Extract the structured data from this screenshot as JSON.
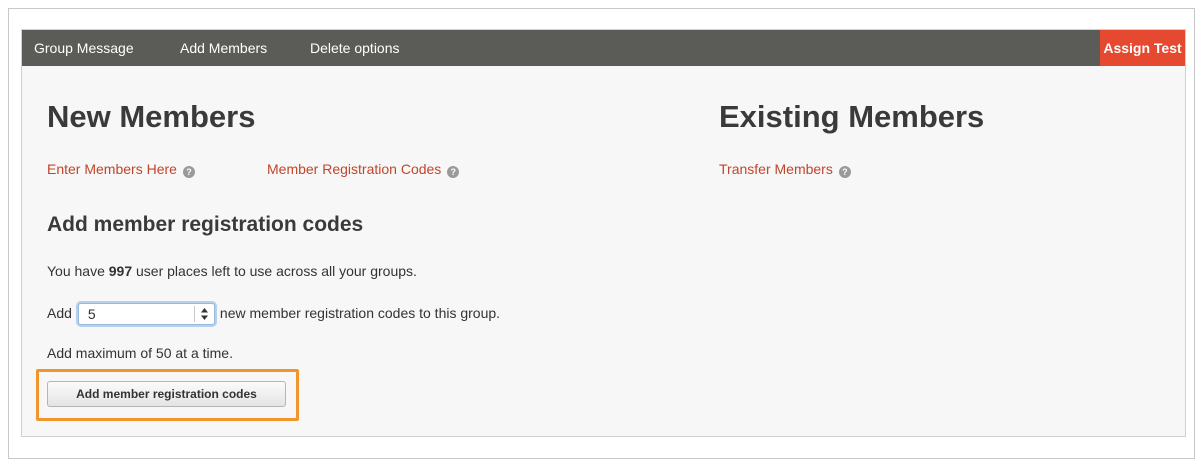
{
  "navbar": {
    "items": [
      "Group Message",
      "Add Members",
      "Delete options"
    ],
    "assign_label": "Assign Test"
  },
  "new_members": {
    "title": "New Members",
    "links": [
      "Enter Members Here",
      "Member Registration Codes"
    ]
  },
  "existing_members": {
    "title": "Existing Members",
    "links": [
      "Transfer Members"
    ]
  },
  "registration": {
    "heading": "Add member registration codes",
    "places_prefix": "You have ",
    "places_count": "997",
    "places_suffix": " user places left to use across all your groups.",
    "add_prefix": "Add",
    "select_value": "5",
    "add_suffix": "new member registration codes to this group.",
    "max_note": "Add maximum of 50 at a time.",
    "button_label": "Add member registration codes"
  },
  "icons": {
    "help": "help-icon",
    "help_glyph": "?",
    "select_arrows": "updown-arrows-icon"
  },
  "colors": {
    "navbar_bg": "#5b5c58",
    "assign_bg": "#e5492f",
    "link": "#c0462b",
    "highlight_border": "#f0962d",
    "select_focus": "#b5d1ee"
  }
}
